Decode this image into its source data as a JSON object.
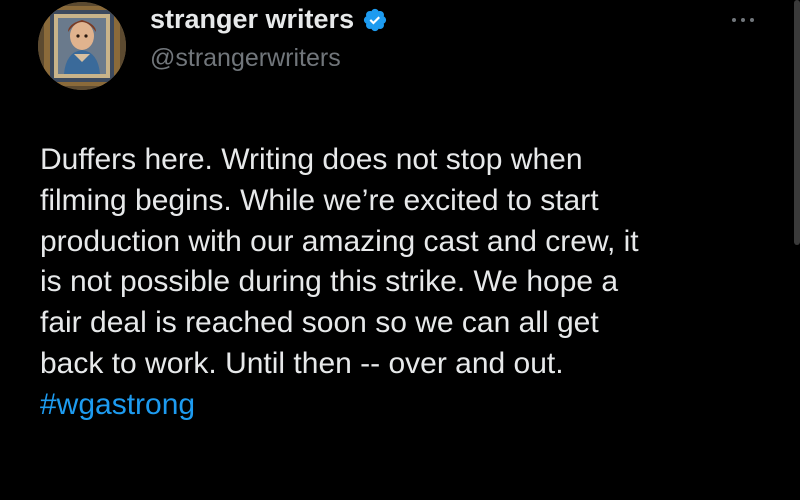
{
  "author": {
    "display_name": "stranger writers",
    "handle": "@strangerwriters",
    "verified": true,
    "verified_color": "#1d9bf0"
  },
  "tweet": {
    "lines": [
      "Duffers here. Writing does not stop when",
      "filming begins. While we’re excited to start",
      "production with our amazing cast and crew, it",
      "is not possible during this strike. We hope a",
      "fair deal is reached soon so we can all get",
      "back to work. Until then -- over and out."
    ],
    "hashtag": "#wgastrong",
    "hashtag_color": "#1d9bf0"
  },
  "icons": {
    "verified": "verified-badge-icon",
    "more": "more-options-icon"
  },
  "colors": {
    "background": "#000000",
    "text": "#e7e9ea",
    "secondary_text": "#71767b"
  }
}
